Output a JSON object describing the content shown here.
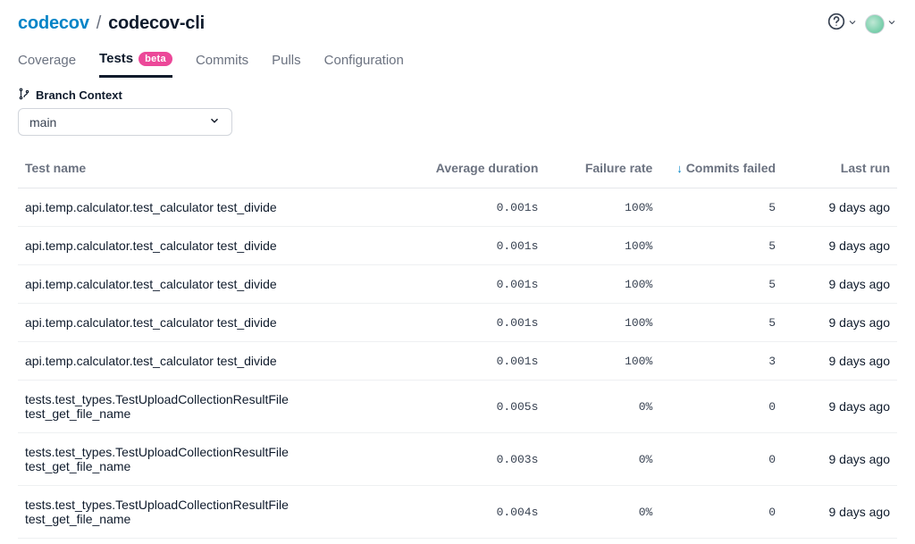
{
  "header": {
    "org": "codecov",
    "separator": "/",
    "repo": "codecov-cli"
  },
  "tabs": {
    "items": [
      {
        "label": "Coverage",
        "active": false,
        "badge": null
      },
      {
        "label": "Tests",
        "active": true,
        "badge": "beta"
      },
      {
        "label": "Commits",
        "active": false,
        "badge": null
      },
      {
        "label": "Pulls",
        "active": false,
        "badge": null
      },
      {
        "label": "Configuration",
        "active": false,
        "badge": null
      }
    ]
  },
  "context": {
    "label": "Branch Context",
    "selected_branch": "main"
  },
  "table": {
    "columns": {
      "name": "Test name",
      "duration": "Average duration",
      "failure": "Failure rate",
      "commits": "Commits failed",
      "last": "Last run"
    },
    "sort": {
      "column": "commits",
      "direction": "desc"
    },
    "rows": [
      {
        "name_l1": "api.temp.calculator.test_calculator test_divide",
        "name_l2": "",
        "duration": "0.001s",
        "failure": "100%",
        "commits": "5",
        "last": "9 days ago"
      },
      {
        "name_l1": "api.temp.calculator.test_calculator test_divide",
        "name_l2": "",
        "duration": "0.001s",
        "failure": "100%",
        "commits": "5",
        "last": "9 days ago"
      },
      {
        "name_l1": "api.temp.calculator.test_calculator test_divide",
        "name_l2": "",
        "duration": "0.001s",
        "failure": "100%",
        "commits": "5",
        "last": "9 days ago"
      },
      {
        "name_l1": "api.temp.calculator.test_calculator test_divide",
        "name_l2": "",
        "duration": "0.001s",
        "failure": "100%",
        "commits": "5",
        "last": "9 days ago"
      },
      {
        "name_l1": "api.temp.calculator.test_calculator test_divide",
        "name_l2": "",
        "duration": "0.001s",
        "failure": "100%",
        "commits": "3",
        "last": "9 days ago"
      },
      {
        "name_l1": "tests.test_types.TestUploadCollectionResultFile",
        "name_l2": "test_get_file_name",
        "duration": "0.005s",
        "failure": "0%",
        "commits": "0",
        "last": "9 days ago"
      },
      {
        "name_l1": "tests.test_types.TestUploadCollectionResultFile",
        "name_l2": "test_get_file_name",
        "duration": "0.003s",
        "failure": "0%",
        "commits": "0",
        "last": "9 days ago"
      },
      {
        "name_l1": "tests.test_types.TestUploadCollectionResultFile",
        "name_l2": "test_get_file_name",
        "duration": "0.004s",
        "failure": "0%",
        "commits": "0",
        "last": "9 days ago"
      }
    ]
  }
}
